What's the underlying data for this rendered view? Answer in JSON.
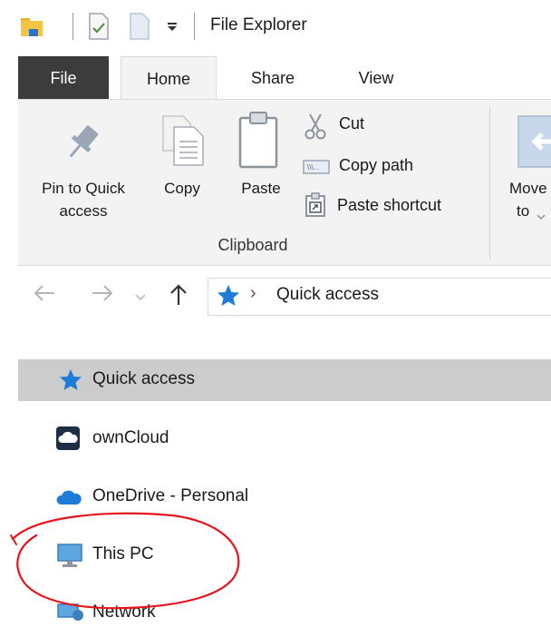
{
  "window": {
    "title": "File Explorer"
  },
  "ribbon": {
    "tabs": [
      {
        "label": "File"
      },
      {
        "label": "Home"
      },
      {
        "label": "Share"
      },
      {
        "label": "View"
      }
    ],
    "active_tab": "Home",
    "pin": {
      "label_line1": "Pin to Quick",
      "label_line2": "access"
    },
    "copy": {
      "label": "Copy"
    },
    "paste": {
      "label": "Paste"
    },
    "cut": {
      "label": "Cut"
    },
    "copy_path": {
      "label": "Copy path"
    },
    "paste_shortcut": {
      "label": "Paste shortcut"
    },
    "group_label": "Clipboard",
    "move_to": {
      "label_line1": "Move",
      "label_line2": "to"
    }
  },
  "address_bar": {
    "separator": "›",
    "location": "Quick access"
  },
  "nav_pane": {
    "items": [
      {
        "label": "Quick access",
        "icon": "quick-access-star-icon",
        "selected": true
      },
      {
        "label": "ownCloud",
        "icon": "owncloud-icon"
      },
      {
        "label": "OneDrive - Personal",
        "icon": "onedrive-cloud-icon"
      },
      {
        "label": "This PC",
        "icon": "monitor-icon"
      },
      {
        "label": "Network",
        "icon": "network-icon"
      }
    ]
  },
  "colors": {
    "file_tab": "#3c3c3c",
    "ribbon_bg": "#f3f3f3",
    "selected_item": "#cccccc",
    "annotation": "#e8141c",
    "accent_blue": "#1f7bd8"
  }
}
